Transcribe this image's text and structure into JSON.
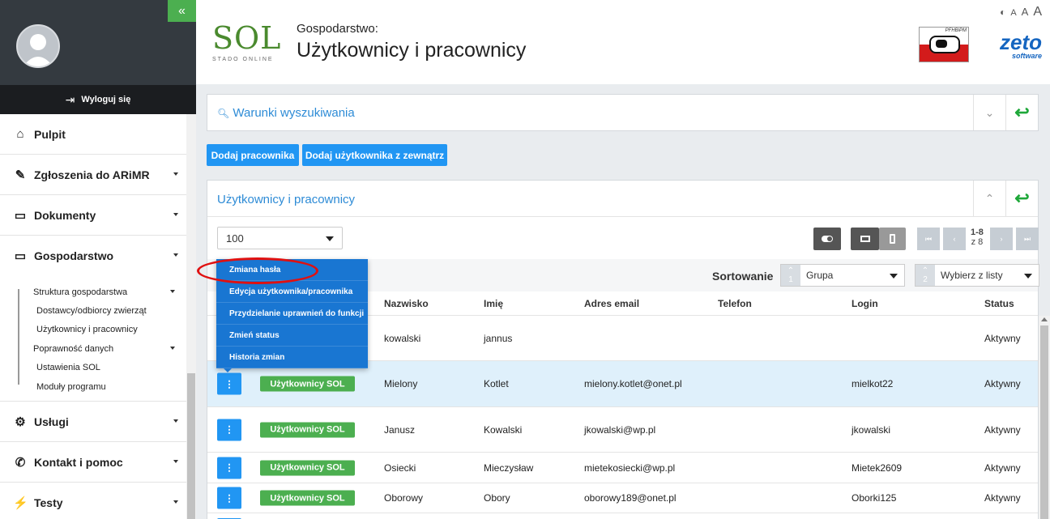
{
  "sidebar": {
    "logout_label": "Wyloguj się",
    "items": [
      {
        "label": "Pulpit",
        "icon": "home-icon",
        "has_caret": false
      },
      {
        "label": "Zgłoszenia do ARiMR",
        "icon": "paperclip-icon",
        "has_caret": true
      },
      {
        "label": "Dokumenty",
        "icon": "inbox-icon",
        "has_caret": true
      },
      {
        "label": "Gospodarstwo",
        "icon": "monitor-icon",
        "has_caret": true
      }
    ],
    "submenu": [
      {
        "label": "Struktura gospodarstwa",
        "level": 1,
        "has_caret": true
      },
      {
        "label": "Dostawcy/odbiorcy zwierząt",
        "level": 2
      },
      {
        "label": "Użytkownicy i pracownicy",
        "level": 2
      },
      {
        "label": "Poprawność danych",
        "level": 1,
        "has_caret": true
      },
      {
        "label": "Ustawienia SOL",
        "level": 1
      },
      {
        "label": "Moduły programu",
        "level": 2
      }
    ],
    "bottom_items": [
      {
        "label": "Usługi",
        "icon": "cogs-icon"
      },
      {
        "label": "Kontakt i pomoc",
        "icon": "phone-icon"
      },
      {
        "label": "Testy",
        "icon": "bolt-icon"
      }
    ]
  },
  "header": {
    "logo_text": "SOL",
    "logo_sub": "STADO ONLINE",
    "subtitle": "Gospodarstwo:",
    "title": "Użytkownicy i pracownicy",
    "pfhb_label": "PFHBiPM",
    "zeto_main": "zeto",
    "zeto_sub": "software"
  },
  "search_panel": {
    "title": "Warunki wyszukiwania"
  },
  "actions": {
    "add_employee": "Dodaj pracownika",
    "add_external_user": "Dodaj użytkownika z zewnątrz"
  },
  "main_panel": {
    "title": "Użytkownicy i pracownicy",
    "page_size": "100",
    "pagination": {
      "range": "1-8",
      "total": "z 8"
    },
    "sort_label": "Sortowanie",
    "sort1": {
      "num": "1",
      "value": "Grupa"
    },
    "sort2": {
      "num": "2",
      "value": "Wybierz z listy"
    },
    "columns": [
      "Nazwisko",
      "Imię",
      "Adres email",
      "Telefon",
      "Login",
      "Status"
    ],
    "rows": [
      {
        "group": "",
        "nazwisko": "kowalski",
        "imie": "jannus",
        "email": "",
        "telefon": "",
        "login": "",
        "status": "Aktywny"
      },
      {
        "group": "Użytkownicy SOL",
        "nazwisko": "Mielony",
        "imie": "Kotlet",
        "email": "mielony.kotlet@onet.pl",
        "telefon": "",
        "login": "mielkot22",
        "status": "Aktywny"
      },
      {
        "group": "Użytkownicy SOL",
        "nazwisko": "Janusz",
        "imie": "Kowalski",
        "email": "jkowalski@wp.pl",
        "telefon": "",
        "login": "jkowalski",
        "status": "Aktywny"
      },
      {
        "group": "Użytkownicy SOL",
        "nazwisko": "Osiecki",
        "imie": "Mieczysław",
        "email": "mietekosiecki@wp.pl",
        "telefon": "",
        "login": "Mietek2609",
        "status": "Aktywny"
      },
      {
        "group": "Użytkownicy SOL",
        "nazwisko": "Oborowy",
        "imie": "Obory",
        "email": "oborowy189@onet.pl",
        "telefon": "",
        "login": "Oborki125",
        "status": "Aktywny"
      }
    ]
  },
  "context_menu": {
    "items": [
      "Zmiana hasła",
      "Edycja użytkownika/pracownika",
      "Przydzielanie uprawnień do funkcji",
      "Zmień status",
      "Historia zmian"
    ]
  },
  "colors": {
    "accent_blue": "#2196f3",
    "group_green": "#4caf50",
    "highlight_red": "#e01010",
    "sidebar_dark": "#343a40"
  }
}
